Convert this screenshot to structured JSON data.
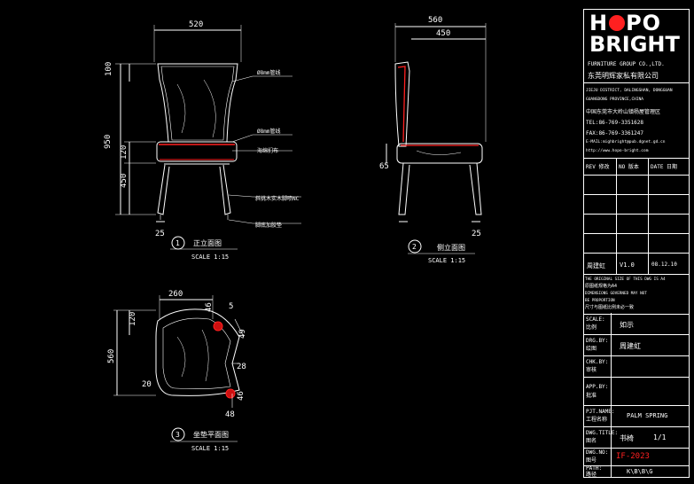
{
  "views": [
    {
      "number": "1",
      "title": "正立面图",
      "scale": "SCALE 1:15"
    },
    {
      "number": "2",
      "title": "侧立面图",
      "scale": "SCALE 1:15"
    },
    {
      "number": "3",
      "title": "坐垫平面图",
      "scale": "SCALE 1:15"
    }
  ],
  "front_dims": {
    "width": "520",
    "top": "100",
    "total": "950",
    "seat": "120",
    "leg": "450",
    "foot": "25"
  },
  "front_notes": [
    "Ø8mm管线",
    "Ø8mm管线",
    "海绵扪布",
    "斜挑木实木脚喷NC",
    "脚底加胶垫"
  ],
  "side_dims": {
    "depth": "560",
    "back": "450",
    "seat_h": "65",
    "foot": "25"
  },
  "plan_dims": {
    "width": "260",
    "back": "120",
    "depth": "560",
    "d46a": "46",
    "d5": "5",
    "d49": "49",
    "d28": "28",
    "d20": "20",
    "d46b": "46",
    "d48": "48"
  },
  "company": {
    "logo_line1": "HOPO",
    "logo_line2": "BRIGHT",
    "group": "FURNITURE GROUP CO.,LTD.",
    "name_cn": "东莞明辉家私有限公司",
    "address_en_1": "JIEJU DISTRICT, DALINGSHAN, DONGGUAN",
    "address_en_2": "GUANGDONG PROVINCE,CHINA",
    "address_cn": "中国东莞市大岭山镇杨屋管理区",
    "tel": "TEL:86-769-3351628",
    "fax": "FAX:86-769-3361247",
    "email": "E-MAIL:mighbright@pub.dgnet.gd.cn",
    "web": "http://www.hopo-bright.com"
  },
  "revision_headers": [
    "REV 修改",
    "NO 版本",
    "DATE 日期"
  ],
  "revision": {
    "name": "周建虹",
    "version": "V1.0",
    "date": "08.12.10"
  },
  "notes": [
    "THE ORIGINAL SIZE OF THIS DWG IS A4",
    "原图纸规格为A4",
    "DIMENSIONS GOVERNED MAY NOT",
    "BE PROPORTION",
    "尺寸与图纸比例未必一致"
  ],
  "fields": [
    {
      "label_en": "SCALE:",
      "label_cn": "比例",
      "value": "如示",
      "red": false
    },
    {
      "label_en": "DRG.BY:",
      "label_cn": "绘图",
      "value": "周建虹",
      "red": false
    },
    {
      "label_en": "CHK.BY:",
      "label_cn": "审核",
      "value": "",
      "red": false
    },
    {
      "label_en": "APP.BY:",
      "label_cn": "批准",
      "value": "",
      "red": false
    },
    {
      "label_en": "PJT.NAME:",
      "label_cn": "工程名称",
      "value": "PALM SPRING",
      "red": false
    },
    {
      "label_en": "DWG.TITLE:",
      "label_cn": "图名",
      "value": "书椅",
      "value2": "1/1",
      "red": false
    },
    {
      "label_en": "DWG.NO:",
      "label_cn": "图号",
      "value": "IF-2023",
      "red": true
    },
    {
      "label_en": "PATH:",
      "label_cn": "路径",
      "value": "K\\B\\B\\G",
      "red": false
    }
  ],
  "colors": {
    "line": "#ffffff",
    "accent": "#ff2020",
    "background": "#000000",
    "dim": "#ffffff"
  }
}
